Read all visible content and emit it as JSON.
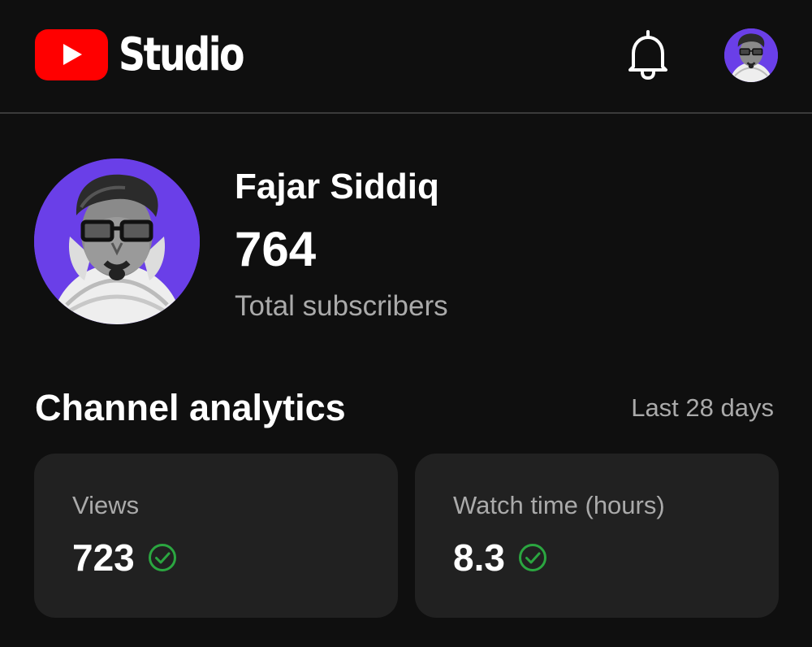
{
  "app": {
    "brand_text": "Studio"
  },
  "header": {
    "logo_icon": "youtube-play-logo",
    "notifications_icon": "bell-icon",
    "account_avatar": "profile-avatar"
  },
  "channel": {
    "name": "Fajar Siddiq",
    "subscribers": "764",
    "subscribers_label": "Total subscribers"
  },
  "analytics": {
    "title": "Channel analytics",
    "period": "Last 28 days",
    "cards": [
      {
        "label": "Views",
        "value": "723",
        "status_icon": "check-circle-icon"
      },
      {
        "label": "Watch time (hours)",
        "value": "8.3",
        "status_icon": "check-circle-icon"
      }
    ]
  },
  "colors": {
    "background": "#0f0f0f",
    "card": "#212121",
    "brand_red": "#ff0000",
    "avatar_bg": "#6a3fe8",
    "secondary_text": "#aaaaaa",
    "success": "#2ba640"
  }
}
